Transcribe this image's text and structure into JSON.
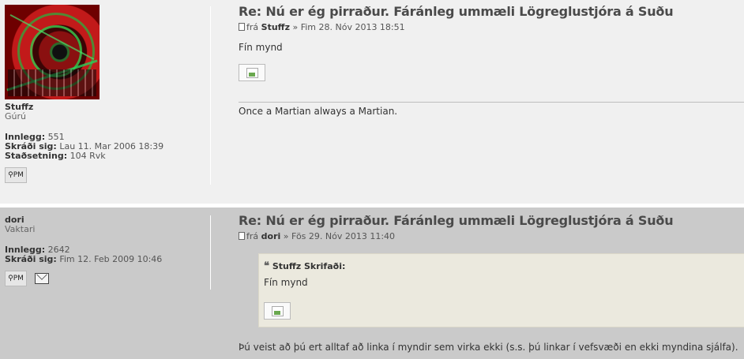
{
  "posts": [
    {
      "author": {
        "name": "Stuffz",
        "rank": "Gúrú",
        "stats": [
          {
            "label": "Innlegg:",
            "value": "551"
          },
          {
            "label": "Skráði sig:",
            "value": "Lau 11. Mar 2006 18:39"
          },
          {
            "label": "Staðsetning:",
            "value": "104 Rvk"
          }
        ],
        "pm_label": "PM"
      },
      "title": "Re: Nú er ég pirraður. Fáránleg ummæli Lögreglustjóra á Suðu",
      "meta": {
        "prefix": "frá",
        "author": "Stuffz",
        "date": "» Fim 28. Nóv 2013 18:51"
      },
      "body": "Fín mynd",
      "signature": "Once a Martian always a Martian."
    },
    {
      "author": {
        "name": "dori",
        "rank": "Vaktari",
        "stats": [
          {
            "label": "Innlegg:",
            "value": "2642"
          },
          {
            "label": "Skráði sig:",
            "value": "Fim 12. Feb 2009 10:46"
          }
        ],
        "pm_label": "PM"
      },
      "title": "Re: Nú er ég pirraður. Fáránleg ummæli Lögreglustjóra á Suðu",
      "meta": {
        "prefix": "frá",
        "author": "dori",
        "date": "» Fös 29. Nóv 2013 11:40"
      },
      "quote": {
        "cite": "Stuffz Skrifaði:",
        "text": "Fín mynd"
      },
      "body": "Þú veist að þú ert alltaf að linka í myndir sem virka ekki (s.s. þú linkar í vefsvæði en ekki myndina sjálfa)."
    }
  ],
  "colors": {
    "post1_bg": "#f0f0f0",
    "post2_bg": "#cacaca",
    "quote_bg": "#ebe9de"
  }
}
